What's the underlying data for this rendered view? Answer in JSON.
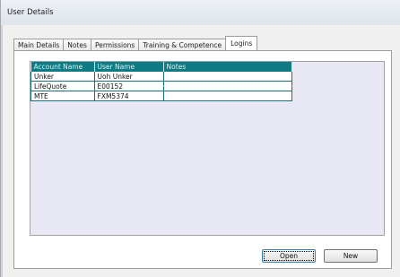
{
  "window": {
    "title": "User Details"
  },
  "tabs": [
    {
      "label": "Main Details",
      "active": false
    },
    {
      "label": "Notes",
      "active": false
    },
    {
      "label": "Permissions",
      "active": false
    },
    {
      "label": "Training & Competence",
      "active": false
    },
    {
      "label": "Logins",
      "active": true
    }
  ],
  "grid": {
    "columns": [
      "Account Name",
      "User Name",
      "Notes"
    ],
    "rows": [
      [
        "Unker",
        "Uoh Unker",
        ""
      ],
      [
        "LifeQuote",
        "E00152",
        ""
      ],
      [
        "MTE",
        "FXM5374",
        ""
      ]
    ],
    "header_color": "#0f7b82"
  },
  "buttons": {
    "open_label": "Open",
    "new_label": "New"
  }
}
